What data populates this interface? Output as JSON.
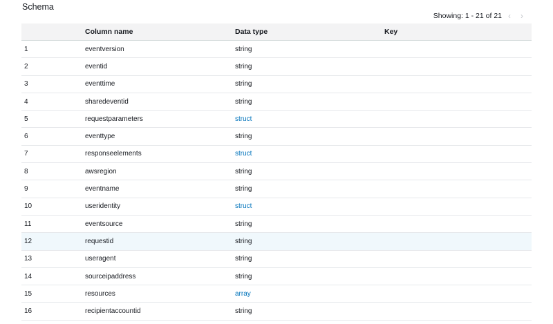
{
  "title": "Schema",
  "pagination": {
    "text": "Showing: 1 - 21 of 21",
    "prev": "‹",
    "next": "›"
  },
  "columns": {
    "num": "",
    "name": "Column name",
    "type": "Data type",
    "key": "Key"
  },
  "colors": {
    "link": "#0073bb",
    "header_bg": "#f3f3f4",
    "highlight_bg": "#f0f8fc"
  },
  "rows": [
    {
      "num": "1",
      "name": "eventversion",
      "type": "string",
      "key": ""
    },
    {
      "num": "2",
      "name": "eventid",
      "type": "string",
      "key": ""
    },
    {
      "num": "3",
      "name": "eventtime",
      "type": "string",
      "key": ""
    },
    {
      "num": "4",
      "name": "sharedeventid",
      "type": "string",
      "key": ""
    },
    {
      "num": "5",
      "name": "requestparameters",
      "type": "struct",
      "key": ""
    },
    {
      "num": "6",
      "name": "eventtype",
      "type": "string",
      "key": ""
    },
    {
      "num": "7",
      "name": "responseelements",
      "type": "struct",
      "key": ""
    },
    {
      "num": "8",
      "name": "awsregion",
      "type": "string",
      "key": ""
    },
    {
      "num": "9",
      "name": "eventname",
      "type": "string",
      "key": ""
    },
    {
      "num": "10",
      "name": "useridentity",
      "type": "struct",
      "key": ""
    },
    {
      "num": "11",
      "name": "eventsource",
      "type": "string",
      "key": ""
    },
    {
      "num": "12",
      "name": "requestid",
      "type": "string",
      "key": ""
    },
    {
      "num": "13",
      "name": "useragent",
      "type": "string",
      "key": ""
    },
    {
      "num": "14",
      "name": "sourceipaddress",
      "type": "string",
      "key": ""
    },
    {
      "num": "15",
      "name": "resources",
      "type": "array",
      "key": ""
    },
    {
      "num": "16",
      "name": "recipientaccountid",
      "type": "string",
      "key": ""
    }
  ]
}
